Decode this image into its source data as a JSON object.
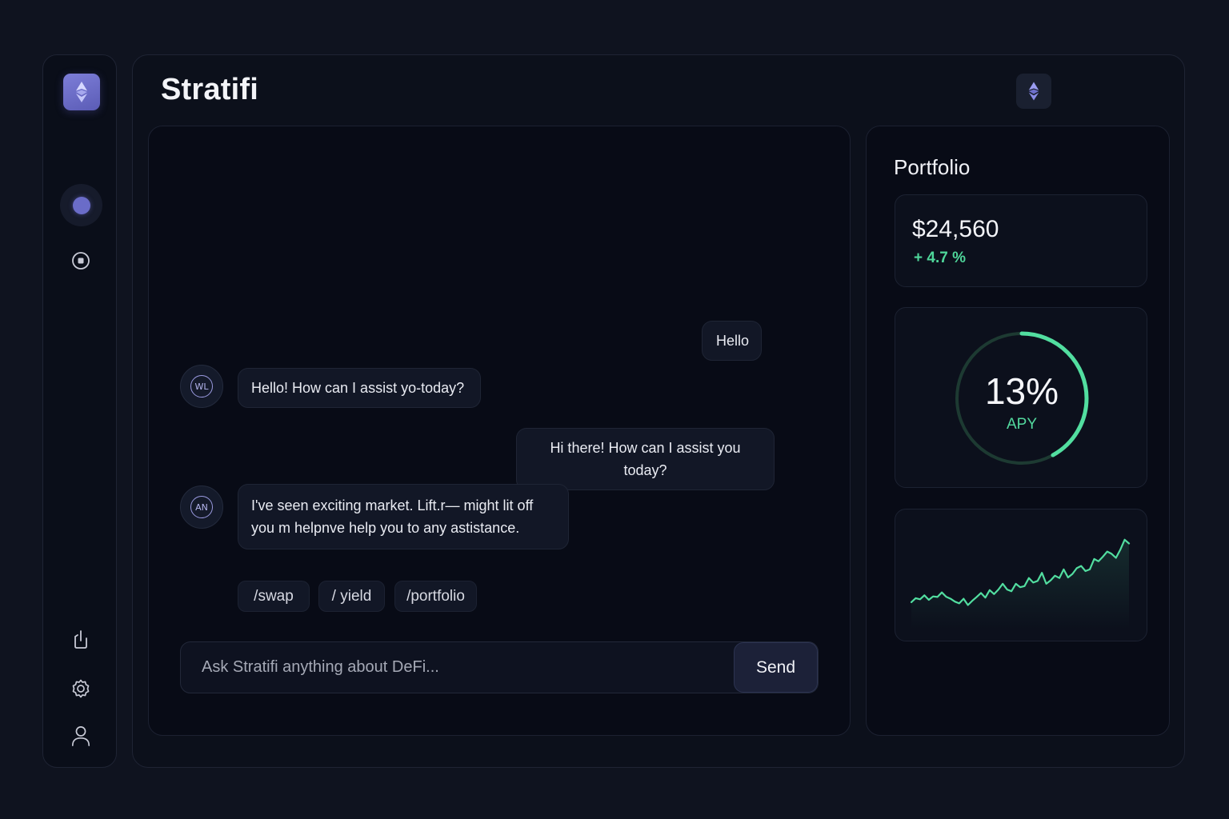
{
  "app": {
    "title": "Stratifi"
  },
  "sidebar": {
    "logo_icon": "ethereum-icon",
    "nav": [
      {
        "icon": "dot-icon",
        "active": true
      },
      {
        "icon": "stop-circle-icon",
        "active": false
      }
    ],
    "bottom": [
      {
        "icon": "power-icon"
      },
      {
        "icon": "gear-icon"
      },
      {
        "icon": "user-icon"
      }
    ]
  },
  "header": {
    "network_icon": "ethereum-icon"
  },
  "chat": {
    "messages": [
      {
        "role": "user",
        "text": "Hello"
      },
      {
        "role": "bot",
        "text": "Hello! How can I assist yo-today?",
        "avatar_glyph": "WL"
      },
      {
        "role": "user",
        "text": "Hi there! How can I assist you today?"
      },
      {
        "role": "bot",
        "line1": "I've seen exciting market. Lift.r— might lit off",
        "line2": "you m helpnve help you to any astistance.",
        "avatar_glyph": "AN"
      }
    ],
    "chips": [
      "/swap",
      "/ yield",
      "/portfolio"
    ],
    "input_placeholder": "Ask Stratifi anything about DeFi...",
    "send_label": "Send"
  },
  "portfolio": {
    "title": "Portfolio",
    "balance": "$24,560",
    "change": "+ 4.7 %",
    "apy_value": "13%",
    "apy_label": "APY",
    "apy_fraction": 0.42,
    "sparkline": [
      0.28,
      0.42,
      0.38,
      0.52,
      0.36,
      0.48,
      0.46,
      0.62,
      0.47,
      0.4,
      0.3,
      0.24,
      0.4,
      0.18,
      0.33,
      0.46,
      0.6,
      0.44,
      0.7,
      0.56,
      0.72,
      0.92,
      0.72,
      0.66,
      0.92,
      0.8,
      0.84,
      1.12,
      0.96,
      1.02,
      1.3,
      0.92,
      1.04,
      1.2,
      1.12,
      1.42,
      1.14,
      1.26,
      1.46,
      1.54,
      1.36,
      1.42,
      1.78,
      1.7,
      1.86,
      2.04,
      1.96,
      1.82,
      2.1,
      2.45,
      2.32
    ],
    "colors": {
      "accent_green": "#4fd69a",
      "accent_purple": "#6a6cc8"
    }
  }
}
